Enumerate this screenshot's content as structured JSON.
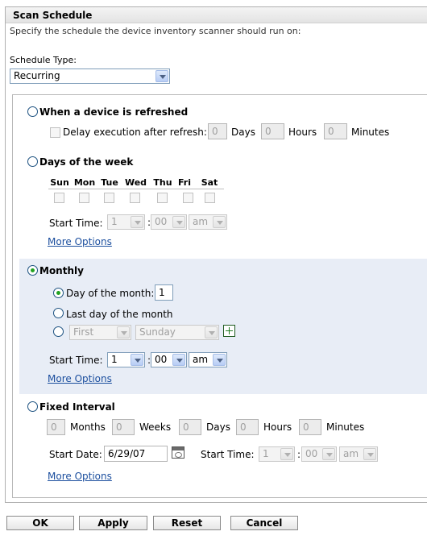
{
  "panel": {
    "title": "Scan Schedule",
    "description": "Specify the schedule the device inventory scanner should run on:"
  },
  "schedule_type": {
    "label": "Schedule Type:",
    "value": "Recurring"
  },
  "refreshed": {
    "label": "When a device is refreshed",
    "delay_label": "Delay execution after refresh:",
    "days_value": "0",
    "days_label": "Days",
    "hours_value": "0",
    "hours_label": "Hours",
    "minutes_value": "0",
    "minutes_label": "Minutes"
  },
  "days_of_week": {
    "label": "Days of the week",
    "days": [
      "Sun",
      "Mon",
      "Tue",
      "Wed",
      "Thu",
      "Fri",
      "Sat"
    ],
    "start_time_label": "Start Time:",
    "hour": "1",
    "minute": "00",
    "ampm": "am",
    "more_options": "More Options"
  },
  "monthly": {
    "label": "Monthly",
    "day_of_month_label": "Day of the month:",
    "day_of_month_value": "1",
    "last_day_label": "Last day of the month",
    "ordinal": "First",
    "weekday": "Sunday",
    "start_time_label": "Start Time:",
    "hour": "1",
    "minute": "00",
    "ampm": "am",
    "more_options": "More Options"
  },
  "fixed_interval": {
    "label": "Fixed Interval",
    "months_value": "0",
    "months_label": "Months",
    "weeks_value": "0",
    "weeks_label": "Weeks",
    "days_value": "0",
    "days_label": "Days",
    "hours_value": "0",
    "hours_label": "Hours",
    "minutes_value": "0",
    "minutes_label": "Minutes",
    "start_date_label": "Start Date:",
    "start_date_value": "6/29/07",
    "start_time_label": "Start Time:",
    "hour": "1",
    "minute": "00",
    "ampm": "am",
    "more_options": "More Options"
  },
  "time_separator": ":",
  "buttons": {
    "ok": "OK",
    "apply": "Apply",
    "reset": "Reset",
    "cancel": "Cancel"
  }
}
